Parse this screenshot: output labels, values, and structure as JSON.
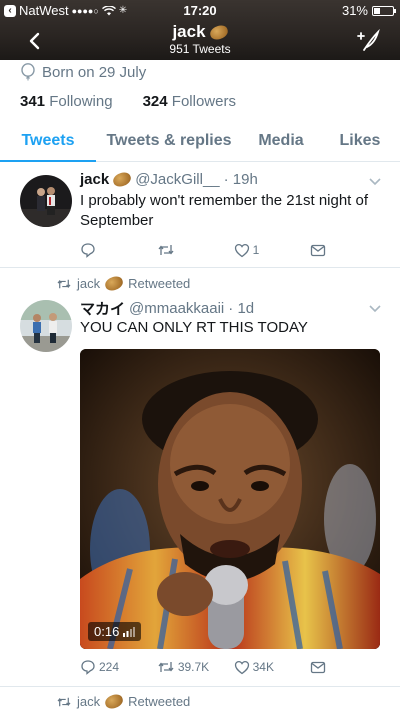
{
  "status": {
    "carrier": "NatWest",
    "signal_dots": "●●●●○",
    "time": "17:20",
    "battery": "31%",
    "battery_level": 0.31
  },
  "nav": {
    "name": "jack",
    "tweet_count": "951 Tweets",
    "back_icon": "chevron-left-icon",
    "compose_icon": "compose-tweet-icon"
  },
  "profile": {
    "born": "Born on 29 July",
    "following_count": "341",
    "following_label": "Following",
    "followers_count": "324",
    "followers_label": "Followers"
  },
  "tabs": [
    {
      "label": "Tweets",
      "active": true
    },
    {
      "label": "Tweets & replies"
    },
    {
      "label": "Media"
    },
    {
      "label": "Likes"
    }
  ],
  "tweets": [
    {
      "name": "jack",
      "handle": "@JackGill__",
      "time": "· 19h",
      "text": "I probably won't remember the 21st night of September",
      "reply": "",
      "retweet": "",
      "like": "1",
      "dm": ""
    },
    {
      "retweeted_by": "jack",
      "retweeted_label": "Retweeted",
      "name": "マカイ",
      "handle": "@mmaakkaaii",
      "time": "· 1d",
      "text": "YOU CAN ONLY RT THIS TODAY",
      "media_duration": "0:16",
      "reply": "224",
      "retweet": "39.7K",
      "like": "34K",
      "dm": ""
    },
    {
      "retweeted_by": "jack",
      "retweeted_label": "Retweeted"
    }
  ],
  "colors": {
    "accent": "#1da1f2",
    "secondary": "#657786",
    "text": "#14171a",
    "divider": "#e1e8ed"
  }
}
